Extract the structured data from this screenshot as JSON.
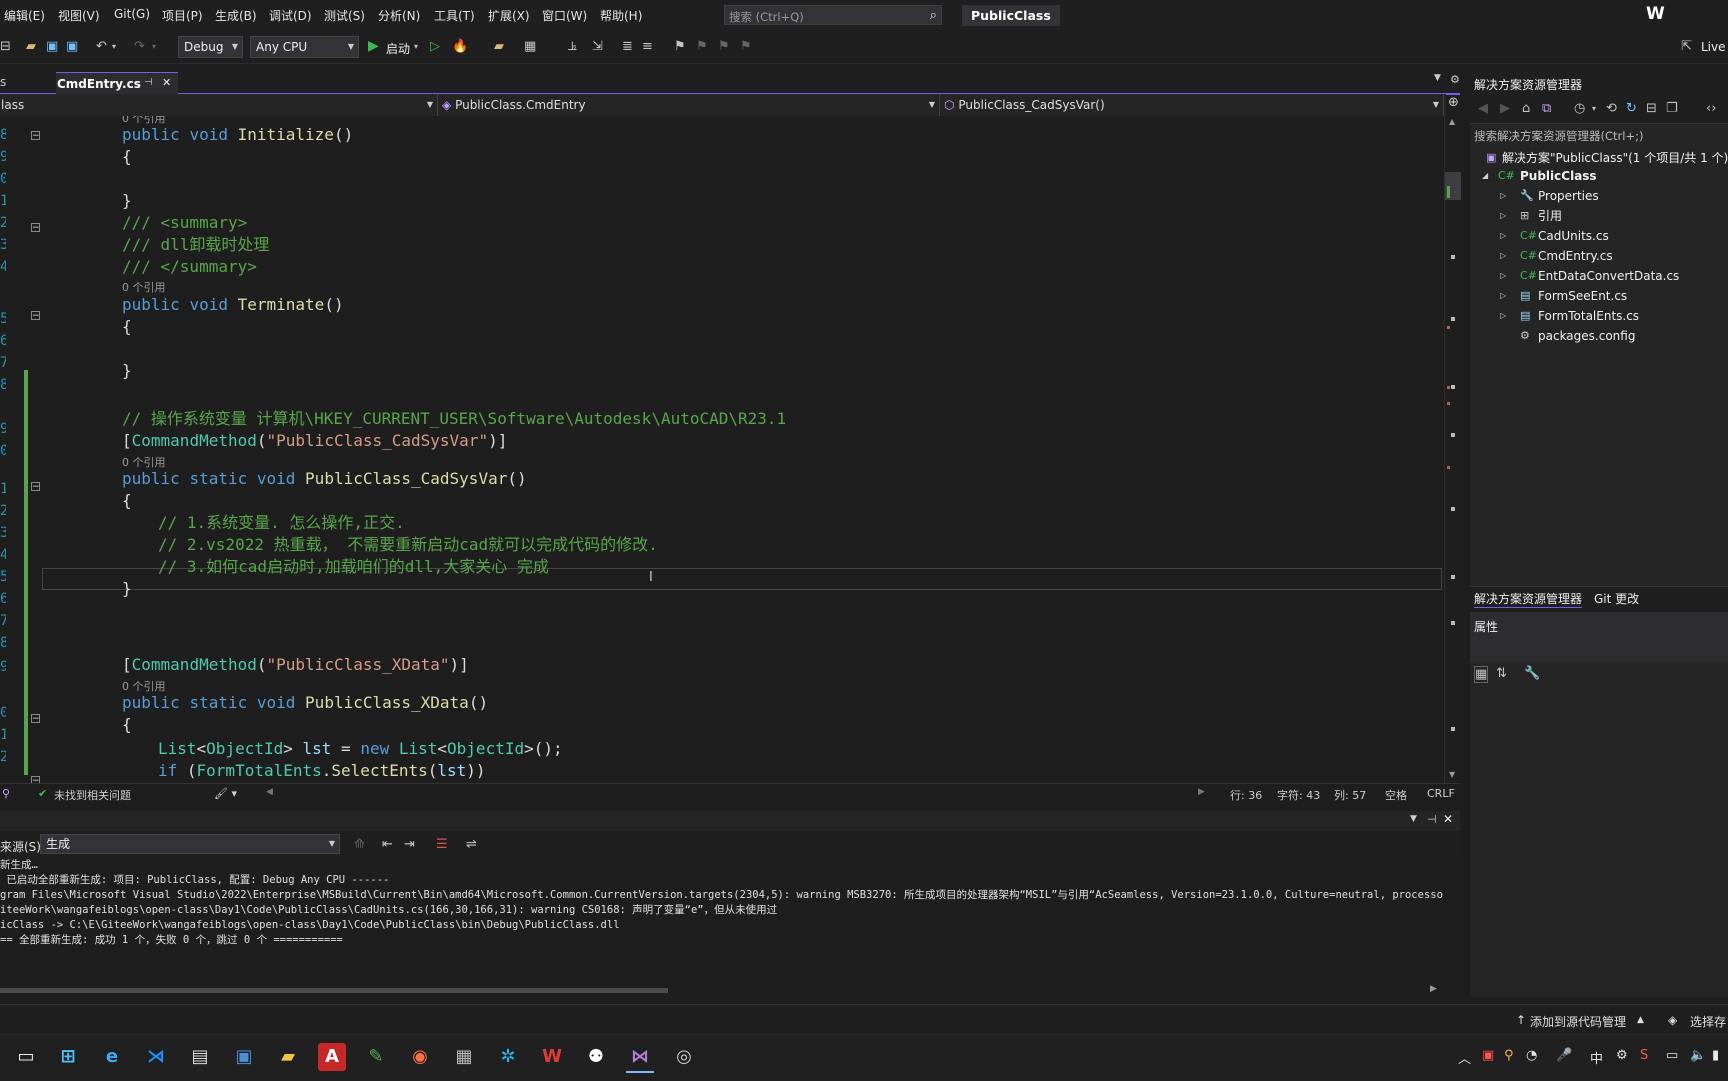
{
  "menu": {
    "items": [
      "编辑(E)",
      "视图(V)",
      "Git(G)",
      "项目(P)",
      "生成(B)",
      "调试(D)",
      "测试(S)",
      "分析(N)",
      "工具(T)",
      "扩展(X)",
      "窗口(W)",
      "帮助(H)"
    ],
    "search_placeholder": "搜索 (Ctrl+Q)",
    "project_title": "PublicClass",
    "user_initial": "W"
  },
  "toolbar": {
    "config": "Debug",
    "platform": "Any CPU",
    "start_label": "启动",
    "live_share": "Live"
  },
  "tabs": {
    "left_fragment": "s",
    "active": "CmdEntry.cs",
    "pin_glyph": "⊣",
    "close_glyph": "✕"
  },
  "navbar": {
    "project": "lass",
    "type": "PublicClass.CmdEntry",
    "member": "PublicClass_CadSysVar()"
  },
  "code": {
    "codelens_top": "0 个引用",
    "l_initialize": "public void Initialize()",
    "brace_open": "{",
    "brace_close": "}",
    "summary_open": "/// <summary>",
    "summary_text": "/// dll卸载时处理",
    "summary_close": "/// </summary>",
    "codelens": "0 个引用",
    "l_terminate": "public void Terminate()",
    "comment_reg": "// 操作系统变量 计算机\\HKEY_CURRENT_USER\\Software\\Autodesk\\AutoCAD\\R23.1",
    "attr_cadsysvar": "\"PublicClass_CadSysVar\"",
    "attr_name": "CommandMethod",
    "l_cadsysvar_name": "PublicClass_CadSysVar",
    "comment_1": "// 1.系统变量. 怎么操作,正交.",
    "comment_2": "// 2.vs2022 热重载， 不需要重新启动cad就可以完成代码的修改.",
    "comment_3": "// 3.如何cad启动时,加载咱们的dll,大家关心 完成",
    "attr_xdata": "\"PublicClass_XData\"",
    "l_xdata_name": "PublicClass_XData",
    "list_type": "List",
    "objid_type": "ObjectId",
    "lst_var": "lst",
    "new_kw": "new",
    "form_class": "FormTotalEnts",
    "select_method": "SelectEnts",
    "line_numbers": [
      "8",
      "9",
      "0",
      "1",
      "2",
      "3",
      "4",
      "5",
      "6",
      "7",
      "8",
      "9",
      "0",
      "1",
      "2",
      "3",
      "4",
      "5",
      "6",
      "7",
      "8",
      "9",
      "0",
      "1",
      "2",
      "3",
      "4"
    ]
  },
  "editor_status": {
    "issues": "未找到相关问题",
    "row": "行: 36",
    "char": "字符: 43",
    "col": "列: 57",
    "space": "空格",
    "eol": "CRLF"
  },
  "output": {
    "source_label": "来源(S):",
    "source_value": "生成",
    "lines": [
      "新生成…",
      " 已启动全部重新生成: 项目: PublicClass, 配置: Debug Any CPU ------",
      "gram Files\\Microsoft Visual Studio\\2022\\Enterprise\\MSBuild\\Current\\Bin\\amd64\\Microsoft.Common.CurrentVersion.targets(2304,5): warning MSB3270: 所生成项目的处理器架构“MSIL”与引用“AcSeamless, Version=23.1.0.0, Culture=neutral, processorArch",
      "iteeWork\\wangafeiblogs\\open-class\\Day1\\Code\\PublicClass\\CadUnits.cs(166,30,166,31): warning CS0168: 声明了变量“e”，但从未使用过",
      "icClass -> C:\\E\\GiteeWork\\wangafeiblogs\\open-class\\Day1\\Code\\PublicClass\\bin\\Debug\\PublicClass.dll",
      "== 全部重新生成: 成功 1 个，失败 0 个，跳过 0 个 ==========="
    ]
  },
  "solution_explorer": {
    "title": "解决方案资源管理器",
    "search": "搜索解决方案资源管理器(Ctrl+;)",
    "solution": "解决方案\"PublicClass\"(1 个项目/共 1 个)",
    "project": "PublicClass",
    "items": [
      {
        "label": "Properties",
        "icon": "wrench-icon",
        "glyph": "🔧"
      },
      {
        "label": "引用",
        "icon": "references-icon",
        "glyph": "⊞"
      },
      {
        "label": "CadUnits.cs",
        "icon": "csharp-file-icon",
        "glyph": "C#"
      },
      {
        "label": "CmdEntry.cs",
        "icon": "csharp-file-icon",
        "glyph": "C#"
      },
      {
        "label": "EntDataConvertData.cs",
        "icon": "csharp-file-icon",
        "glyph": "C#"
      },
      {
        "label": "FormSeeEnt.cs",
        "icon": "form-file-icon",
        "glyph": "▤"
      },
      {
        "label": "FormTotalEnts.cs",
        "icon": "form-file-icon",
        "glyph": "▤"
      },
      {
        "label": "packages.config",
        "icon": "config-file-icon",
        "glyph": "⚙"
      }
    ],
    "tab_solution": "解决方案资源管理器",
    "tab_git": "Git 更改",
    "properties_title": "属性"
  },
  "status_bar": {
    "add_source_control": "添加到源代码管理",
    "select_repo": "选择存"
  },
  "taskbar": {
    "ime": "中",
    "colors": {
      "accent": "#7160e8",
      "vs_purple": "#68217a",
      "comment": "#57a64a",
      "keyword": "#569cd6"
    }
  }
}
